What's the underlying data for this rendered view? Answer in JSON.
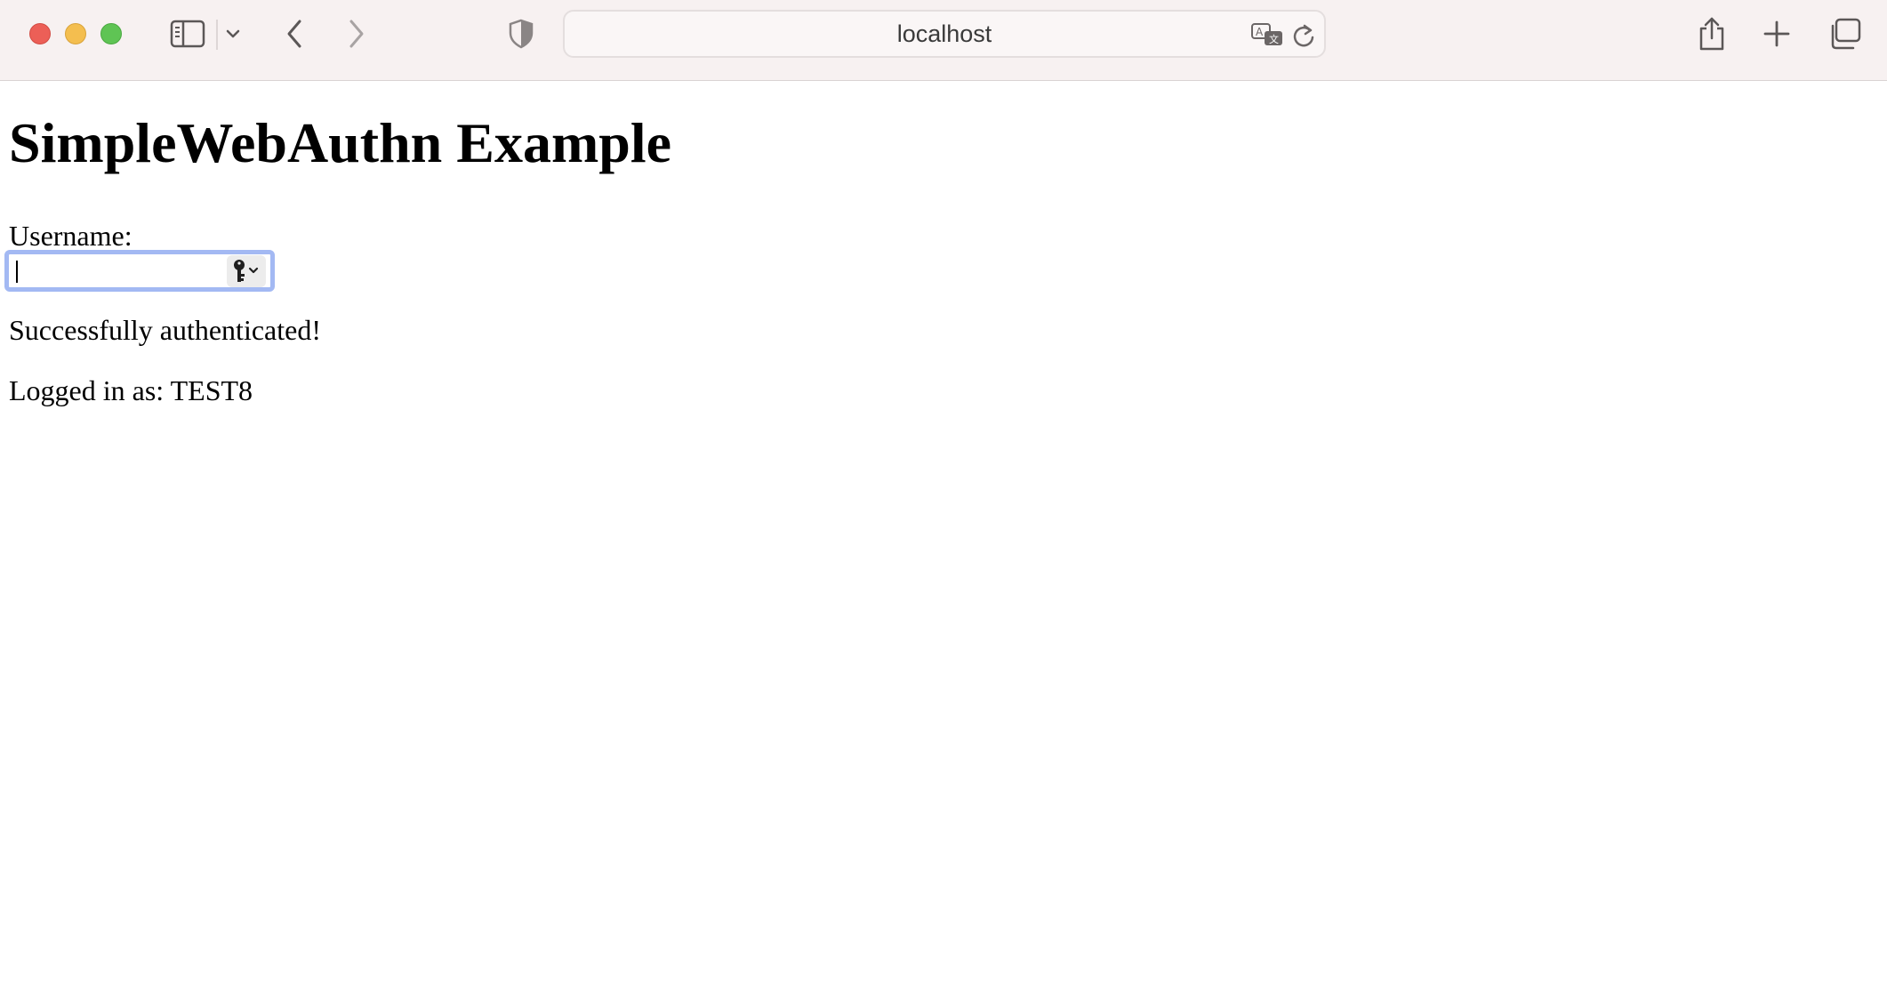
{
  "browser": {
    "address": "localhost",
    "icons": {
      "sidebar": "sidebar-icon",
      "tab_group_menu": "chevron-down-icon",
      "back": "chevron-left-icon",
      "forward": "chevron-right-icon",
      "privacy": "shield-icon",
      "translate": "translate-icon",
      "reload": "reload-icon",
      "share": "share-icon",
      "new_tab": "plus-icon",
      "tab_overview": "tabs-overview-icon"
    },
    "colors": {
      "close": "#ec5f57",
      "minimize": "#f4be4f",
      "maximize": "#5fc454",
      "toolbar_bg": "#f7f1f1",
      "focus_ring": "#a3b9f3"
    }
  },
  "page": {
    "title": "SimpleWebAuthn Example",
    "username_label": "Username:",
    "username_value": "",
    "passkey_icon": "key-icon",
    "status": "Successfully authenticated!",
    "logged_in": "Logged in as: TEST8"
  }
}
